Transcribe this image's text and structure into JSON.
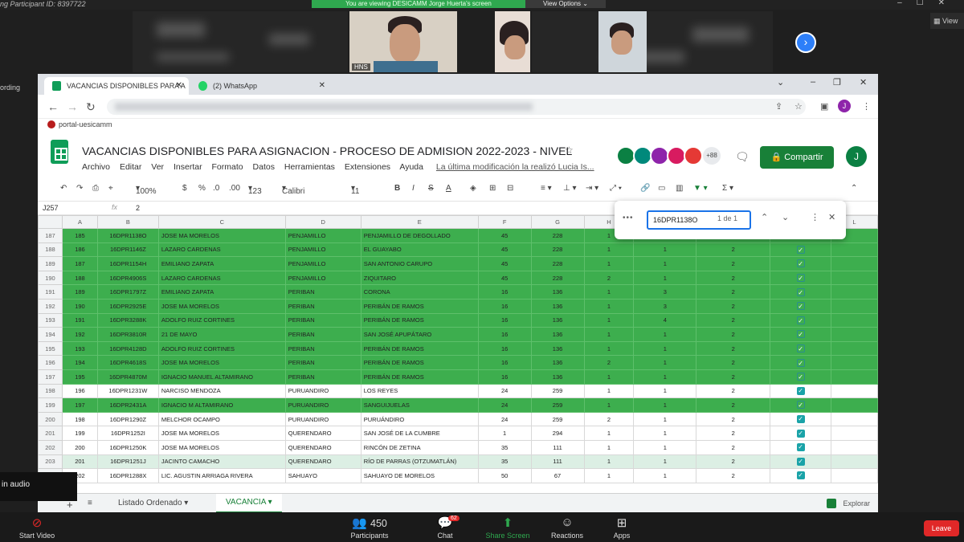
{
  "zoom": {
    "participant_id": "ng Participant ID: 8397722",
    "banner": "You are viewing DESICAMM Jorge Huerta's screen",
    "view_options": "View Options",
    "view": "View",
    "hns": "HNS",
    "recording": "ording",
    "audio": "in audio"
  },
  "browser": {
    "tabs": [
      {
        "label": "VACANCIAS DISPONIBLES PARA A"
      },
      {
        "label": "(2) WhatsApp"
      }
    ],
    "bookmark": "portal-uesicamm",
    "avatar": "J"
  },
  "sheet": {
    "title": "VACANCIAS DISPONIBLES PARA ASIGNACION - PROCESO DE ADMISION 2022-2023 - NIVEL ...",
    "menus": [
      "Archivo",
      "Editar",
      "Ver",
      "Insertar",
      "Formato",
      "Datos",
      "Herramientas",
      "Extensiones",
      "Ayuda"
    ],
    "last_edit": "La última modificación la realizó Lucia Is...",
    "more_users": "+88",
    "share": "Compartir",
    "user_avatar": "J",
    "toolbar": {
      "zoom": "100%",
      "currency": "$",
      "percent": "%",
      "dec_less": ".0",
      "dec_more": ".00",
      "format": "123",
      "font": "Calibri",
      "size": "11",
      "bold": "B",
      "italic": "I",
      "strike": "S",
      "text_color": "A"
    },
    "cell_ref": "J257",
    "fx": "fx",
    "cell_value": "2",
    "find": {
      "query": "16DPR1138O",
      "count": "1 de 1"
    },
    "columns": [
      "A",
      "B",
      "C",
      "D",
      "E",
      "F",
      "G",
      "H",
      "",
      "",
      "",
      "L"
    ],
    "rows": [
      {
        "r": "187",
        "a": "185",
        "b": "16DPR1138O",
        "c": "JOSE MA MORELOS",
        "d": "PENJAMILLO",
        "e": "PENJAMILLO DE DEGOLLADO",
        "f": "45",
        "g": "228",
        "h": "1",
        "i": "1",
        "j": "2",
        "k": true,
        "g_": 1
      },
      {
        "r": "188",
        "a": "186",
        "b": "16DPR1146Z",
        "c": "LAZARO CARDENAS",
        "d": "PENJAMILLO",
        "e": "EL GUAYABO",
        "f": "45",
        "g": "228",
        "h": "1",
        "i": "1",
        "j": "2",
        "k": true,
        "g_": 1
      },
      {
        "r": "189",
        "a": "187",
        "b": "16DPR1154H",
        "c": "EMILIANO ZAPATA",
        "d": "PENJAMILLO",
        "e": "SAN ANTONIO CARUPO",
        "f": "45",
        "g": "228",
        "h": "1",
        "i": "1",
        "j": "2",
        "k": true,
        "g_": 1
      },
      {
        "r": "190",
        "a": "188",
        "b": "16DPR4906S",
        "c": "LAZARO CARDENAS",
        "d": "PENJAMILLO",
        "e": "ZIQUITARO",
        "f": "45",
        "g": "228",
        "h": "2",
        "i": "1",
        "j": "2",
        "k": true,
        "g_": 1
      },
      {
        "r": "191",
        "a": "189",
        "b": "16DPR1797Z",
        "c": "EMILIANO ZAPATA",
        "d": "PERIBAN",
        "e": "CORONA",
        "f": "16",
        "g": "136",
        "h": "1",
        "i": "3",
        "j": "2",
        "k": true,
        "g_": 1
      },
      {
        "r": "192",
        "a": "190",
        "b": "16DPR2925E",
        "c": "JOSE MA MORELOS",
        "d": "PERIBAN",
        "e": "PERIBÁN DE RAMOS",
        "f": "16",
        "g": "136",
        "h": "1",
        "i": "3",
        "j": "2",
        "k": true,
        "g_": 1
      },
      {
        "r": "193",
        "a": "191",
        "b": "16DPR3288K",
        "c": "ADOLFO RUIZ CORTINES",
        "d": "PERIBAN",
        "e": "PERIBÁN DE RAMOS",
        "f": "16",
        "g": "136",
        "h": "1",
        "i": "4",
        "j": "2",
        "k": true,
        "g_": 1
      },
      {
        "r": "194",
        "a": "192",
        "b": "16DPR3810R",
        "c": "21 DE MAYO",
        "d": "PERIBAN",
        "e": "SAN JOSÉ APUPÁTARO",
        "f": "16",
        "g": "136",
        "h": "1",
        "i": "1",
        "j": "2",
        "k": true,
        "g_": 1
      },
      {
        "r": "195",
        "a": "193",
        "b": "16DPR4128D",
        "c": "ADOLFO RUIZ CORTINES",
        "d": "PERIBAN",
        "e": "PERIBÁN DE RAMOS",
        "f": "16",
        "g": "136",
        "h": "1",
        "i": "1",
        "j": "2",
        "k": true,
        "g_": 1
      },
      {
        "r": "196",
        "a": "194",
        "b": "16DPR4618S",
        "c": "JOSE MA MORELOS",
        "d": "PERIBAN",
        "e": "PERIBÁN DE RAMOS",
        "f": "16",
        "g": "136",
        "h": "2",
        "i": "1",
        "j": "2",
        "k": true,
        "g_": 1
      },
      {
        "r": "197",
        "a": "195",
        "b": "16DPR4870M",
        "c": "IGNACIO MANUEL ALTAMIRANO",
        "d": "PERIBAN",
        "e": "PERIBÁN DE RAMOS",
        "f": "16",
        "g": "136",
        "h": "1",
        "i": "1",
        "j": "2",
        "k": true,
        "g_": 1
      },
      {
        "r": "198",
        "a": "196",
        "b": "16DPR1231W",
        "c": "NARCISO MENDOZA",
        "d": "PURUANDIRO",
        "e": "LOS REYES",
        "f": "24",
        "g": "259",
        "h": "1",
        "i": "1",
        "j": "2",
        "k": true,
        "g_": 0
      },
      {
        "r": "199",
        "a": "197",
        "b": "16DPR2431A",
        "c": "IGNACIO M ALTAMIRANO",
        "d": "PURUANDIRO",
        "e": "SANGUIJUELAS",
        "f": "24",
        "g": "259",
        "h": "1",
        "i": "1",
        "j": "2",
        "k": true,
        "g_": 1
      },
      {
        "r": "200",
        "a": "198",
        "b": "16DPR1290Z",
        "c": "MELCHOR OCAMPO",
        "d": "PURUANDIRO",
        "e": "PURUÁNDIRO",
        "f": "24",
        "g": "259",
        "h": "2",
        "i": "1",
        "j": "2",
        "k": true,
        "g_": 0
      },
      {
        "r": "201",
        "a": "199",
        "b": "16DPR1252I",
        "c": "JOSE MA MORELOS",
        "d": "QUERENDARO",
        "e": "SAN JOSÉ DE LA CUMBRE",
        "f": "1",
        "g": "294",
        "h": "1",
        "i": "1",
        "j": "2",
        "k": true,
        "g_": 0
      },
      {
        "r": "202",
        "a": "200",
        "b": "16DPR1250K",
        "c": "JOSE MA MORELOS",
        "d": "QUERENDARO",
        "e": "RINCÓN DE ZETINA",
        "f": "35",
        "g": "111",
        "h": "1",
        "i": "1",
        "j": "2",
        "k": true,
        "g_": 0
      },
      {
        "r": "203",
        "a": "201",
        "b": "16DPR1251J",
        "c": "JACINTO CAMACHO",
        "d": "QUERENDARO",
        "e": "RÍO DE PARRAS (OTZUMATLÁN)",
        "f": "35",
        "g": "111",
        "h": "1",
        "i": "1",
        "j": "2",
        "k": true,
        "g_": 2
      },
      {
        "r": "204",
        "a": "202",
        "b": "16DPR1288X",
        "c": "LIC. AGUSTIN ARRIAGA RIVERA",
        "d": "SAHUAYO",
        "e": "SAHUAYO DE MORELOS",
        "f": "50",
        "g": "67",
        "h": "1",
        "i": "1",
        "j": "2",
        "k": true,
        "g_": 0
      }
    ],
    "sheet_tabs": [
      "Listado Ordenado",
      "VACANCIA"
    ],
    "explore": "Explorar"
  },
  "zoombar": {
    "start_video": "Start Video",
    "participants": "Participants",
    "participants_count": "450",
    "chat": "Chat",
    "chat_badge": "62",
    "share_screen": "Share Screen",
    "reactions": "Reactions",
    "apps": "Apps",
    "leave": "Leave"
  }
}
